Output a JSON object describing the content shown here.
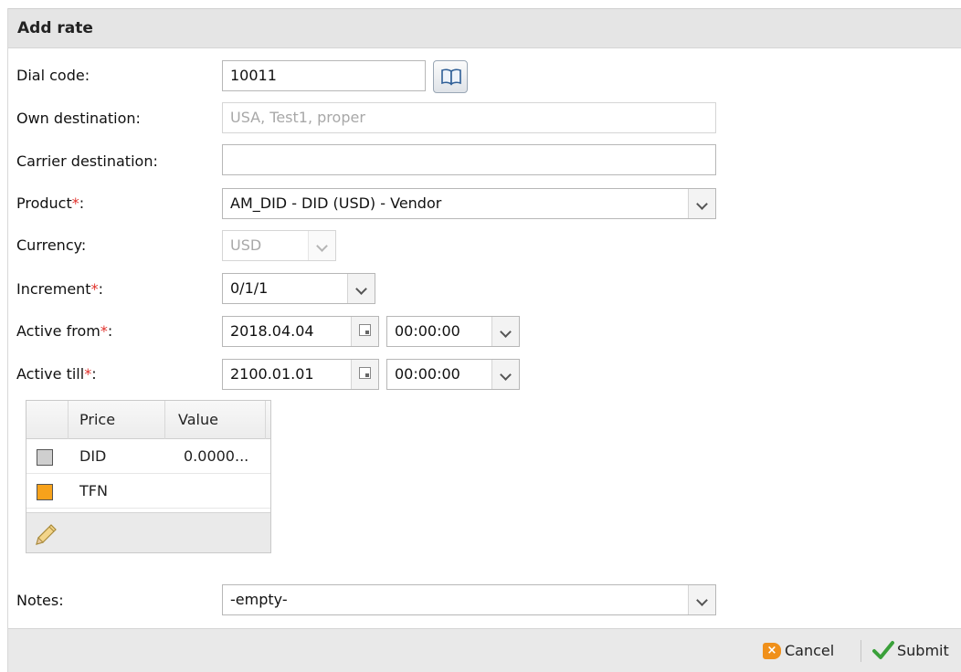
{
  "dialog": {
    "title": "Add rate"
  },
  "form": {
    "dial_code": {
      "label": "Dial code:",
      "value": "10011"
    },
    "own_destination": {
      "label": "Own destination:",
      "placeholder": "USA, Test1, proper"
    },
    "carrier_destination": {
      "label": "Carrier destination:",
      "value": ""
    },
    "product": {
      "label": "Product",
      "required_mark": "*",
      "label_suffix": ":",
      "value": "AM_DID - DID (USD) - Vendor"
    },
    "currency": {
      "label": "Currency:",
      "value": "USD"
    },
    "increment": {
      "label": "Increment",
      "required_mark": "*",
      "label_suffix": ":",
      "value": "0/1/1"
    },
    "active_from": {
      "label": "Active from",
      "required_mark": "*",
      "label_suffix": ":",
      "date": "2018.04.04",
      "time": "00:00:00"
    },
    "active_till": {
      "label": "Active till",
      "required_mark": "*",
      "label_suffix": ":",
      "date": "2100.01.01",
      "time": "00:00:00"
    },
    "notes": {
      "label": "Notes:",
      "value": "-empty-"
    }
  },
  "price_grid": {
    "columns": [
      "Price",
      "Value"
    ],
    "rows": [
      {
        "name": "DID",
        "value": "0.0000...",
        "color": "#cfcfcf"
      },
      {
        "name": "TFN",
        "value": "",
        "color": "#f7a21b"
      }
    ]
  },
  "footer": {
    "cancel_label": "Cancel",
    "submit_label": "Submit"
  },
  "icons": {
    "book": "book-icon",
    "calendar": "calendar-icon",
    "edit": "pencil-icon",
    "cancel": "cancel-icon",
    "submit": "checkmark-icon"
  },
  "colors": {
    "required": "#e0302a",
    "cancel_icon": "#f0901a",
    "submit_icon": "#3aa03a"
  }
}
